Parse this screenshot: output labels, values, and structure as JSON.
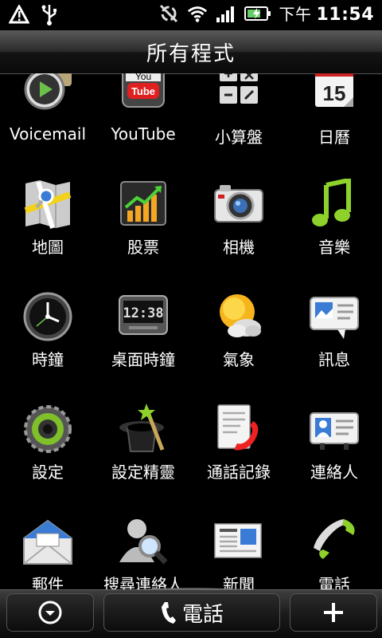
{
  "status": {
    "ampm": "下午",
    "time": "11:54",
    "icons": [
      "warning-icon",
      "usb-icon",
      "sync-off-icon",
      "wifi-icon",
      "signal-icon",
      "battery-charging-icon"
    ]
  },
  "title": "所有程式",
  "apps": [
    {
      "label": "Voicemail",
      "icon": "voicemail-icon"
    },
    {
      "label": "YouTube",
      "icon": "youtube-icon"
    },
    {
      "label": "小算盤",
      "icon": "calculator-icon"
    },
    {
      "label": "日曆",
      "icon": "calendar-icon",
      "icon_text": "15"
    },
    {
      "label": "地圖",
      "icon": "maps-icon"
    },
    {
      "label": "股票",
      "icon": "stocks-icon"
    },
    {
      "label": "相機",
      "icon": "camera-icon"
    },
    {
      "label": "音樂",
      "icon": "music-icon"
    },
    {
      "label": "時鐘",
      "icon": "clock-icon"
    },
    {
      "label": "桌面時鐘",
      "icon": "desk-clock-icon",
      "icon_text": "12:38"
    },
    {
      "label": "氣象",
      "icon": "weather-icon"
    },
    {
      "label": "訊息",
      "icon": "messages-icon"
    },
    {
      "label": "設定",
      "icon": "settings-icon"
    },
    {
      "label": "設定精靈",
      "icon": "setup-wizard-icon"
    },
    {
      "label": "通話記錄",
      "icon": "call-history-icon"
    },
    {
      "label": "連絡人",
      "icon": "contacts-icon"
    },
    {
      "label": "郵件",
      "icon": "mail-icon"
    },
    {
      "label": "搜尋連絡人",
      "icon": "search-contacts-icon"
    },
    {
      "label": "新聞",
      "icon": "news-icon"
    },
    {
      "label": "電話",
      "icon": "phone-icon"
    }
  ],
  "dock": {
    "left_icon": "collapse-down-icon",
    "center_label": "電話",
    "center_icon": "phone-handset-icon",
    "right_icon": "plus-icon"
  }
}
